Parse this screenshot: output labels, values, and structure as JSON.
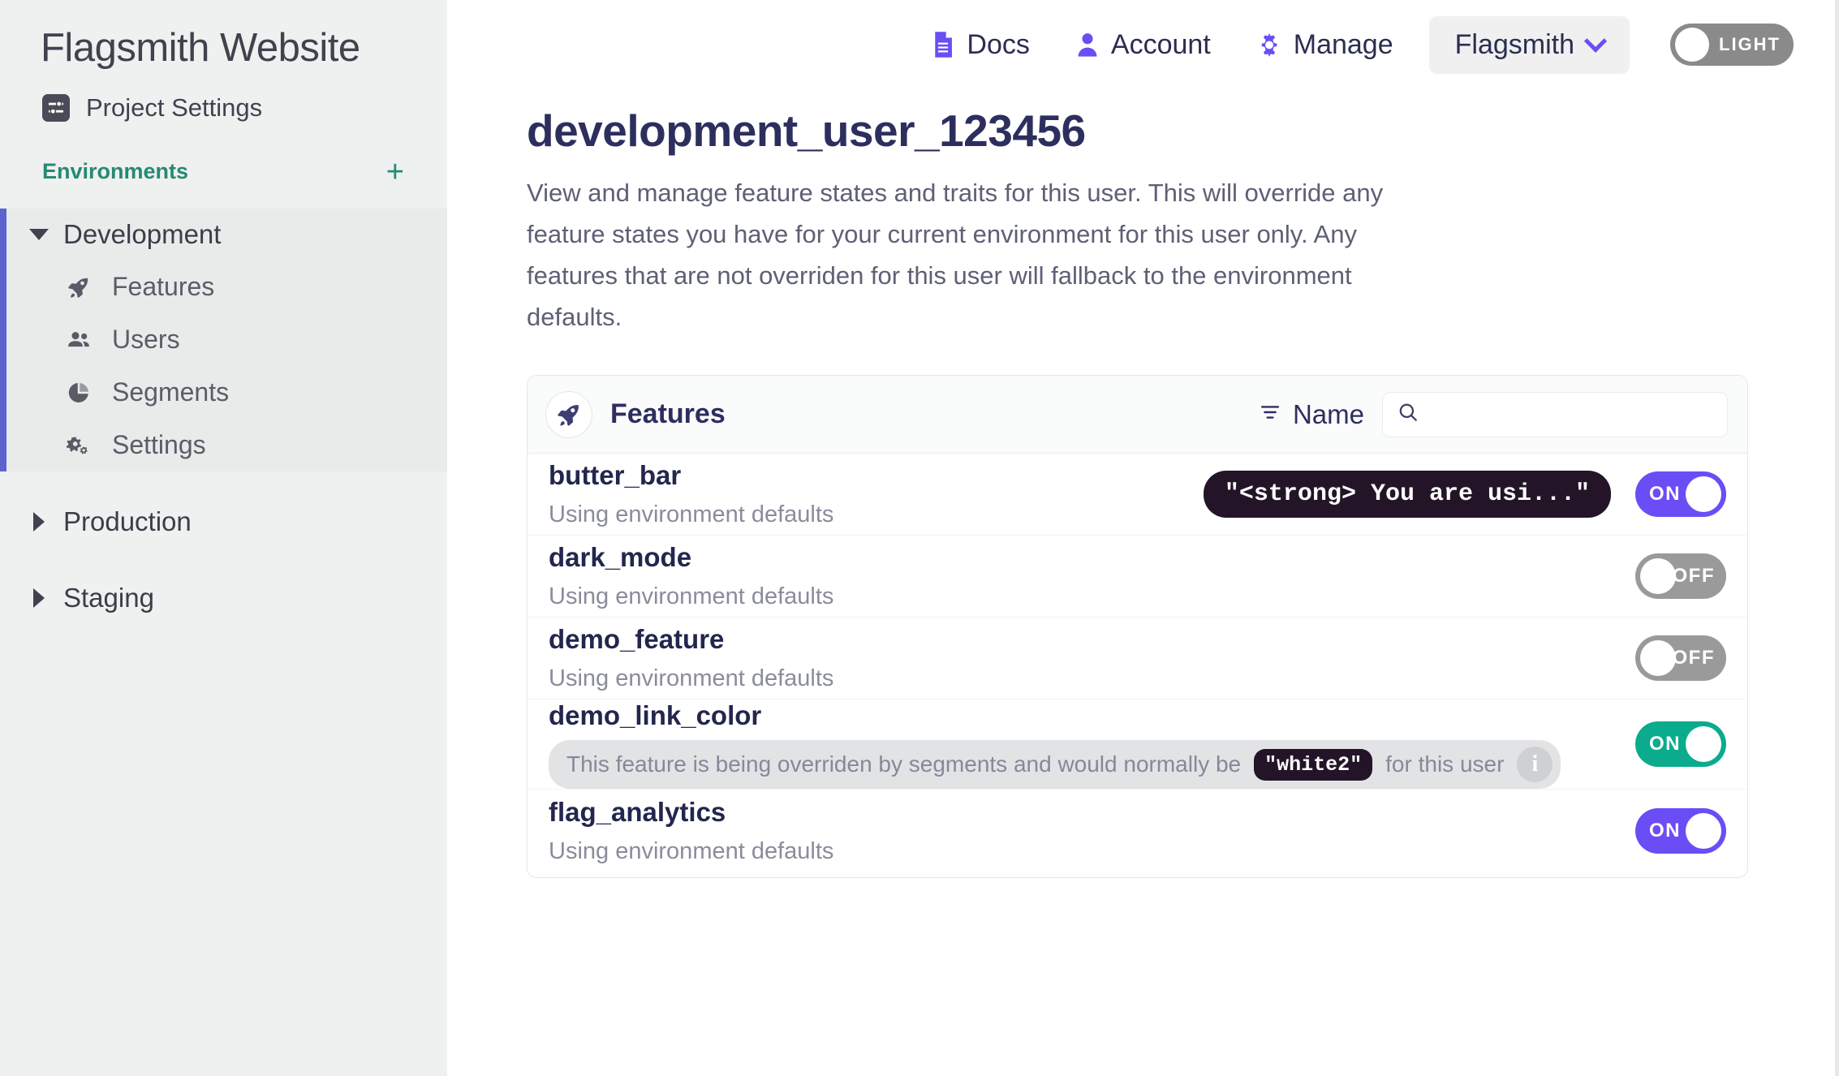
{
  "sidebar": {
    "brand": "Flagsmith Website",
    "project_settings": {
      "label": "Project Settings",
      "icon": "sliders-icon"
    },
    "environments_header": {
      "label": "Environments",
      "add_label": "+"
    },
    "environments": [
      {
        "name": "Development",
        "expanded": true,
        "active": true,
        "items": [
          {
            "label": "Features",
            "icon": "rocket-icon"
          },
          {
            "label": "Users",
            "icon": "users-icon"
          },
          {
            "label": "Segments",
            "icon": "pie-chart-icon"
          },
          {
            "label": "Settings",
            "icon": "gears-icon"
          }
        ]
      },
      {
        "name": "Production",
        "expanded": false,
        "active": false,
        "items": []
      },
      {
        "name": "Staging",
        "expanded": false,
        "active": false,
        "items": []
      }
    ]
  },
  "topbar": {
    "nav": [
      {
        "label": "Docs",
        "icon": "document-icon"
      },
      {
        "label": "Account",
        "icon": "person-icon"
      },
      {
        "label": "Manage",
        "icon": "gear-icon"
      }
    ],
    "organisation": {
      "name": "Flagsmith",
      "icon": "chevron-down-icon"
    },
    "theme": {
      "label": "LIGHT",
      "state": "off"
    }
  },
  "page": {
    "title": "development_user_123456",
    "description": "View and manage feature states and traits for this user. This will override any feature states you have for your current environment for this user only. Any features that are not overriden for this user will fallback to the environment defaults."
  },
  "features_card": {
    "title": "Features",
    "icon": "rocket-icon",
    "sort": {
      "label": "Name",
      "icon": "filter-icon"
    },
    "search": {
      "value": "",
      "placeholder": "",
      "icon": "search-icon"
    },
    "rows": [
      {
        "name": "butter_bar",
        "subtitle": "Using environment defaults",
        "value_chip": "\"<strong> You are usi...\"",
        "toggle": {
          "label": "ON",
          "state": "on",
          "color": "#6b4df6"
        }
      },
      {
        "name": "dark_mode",
        "subtitle": "Using environment defaults",
        "value_chip": null,
        "toggle": {
          "label": "OFF",
          "state": "off",
          "color": "#9a9a9a"
        }
      },
      {
        "name": "demo_feature",
        "subtitle": "Using environment defaults",
        "value_chip": null,
        "toggle": {
          "label": "OFF",
          "state": "off",
          "color": "#9a9a9a"
        }
      },
      {
        "name": "demo_link_color",
        "override": {
          "prefix": "This feature is being overriden by segments and would normally be",
          "chip": "\"white2\"",
          "suffix": "for this user",
          "info_icon": "info-icon"
        },
        "toggle": {
          "label": "ON",
          "state": "on",
          "color": "#0bab8d"
        }
      },
      {
        "name": "flag_analytics",
        "subtitle": "Using environment defaults",
        "value_chip": null,
        "toggle": {
          "label": "ON",
          "state": "on",
          "color": "#6b4df6"
        }
      }
    ]
  },
  "colors": {
    "accent_purple": "#6b4df6",
    "accent_teal": "#0bab8d",
    "env_active_border": "#5d62d1",
    "title_navy": "#2c2f5e",
    "sidebar_bg": "#eff0f0",
    "chip_dark": "#231527"
  }
}
